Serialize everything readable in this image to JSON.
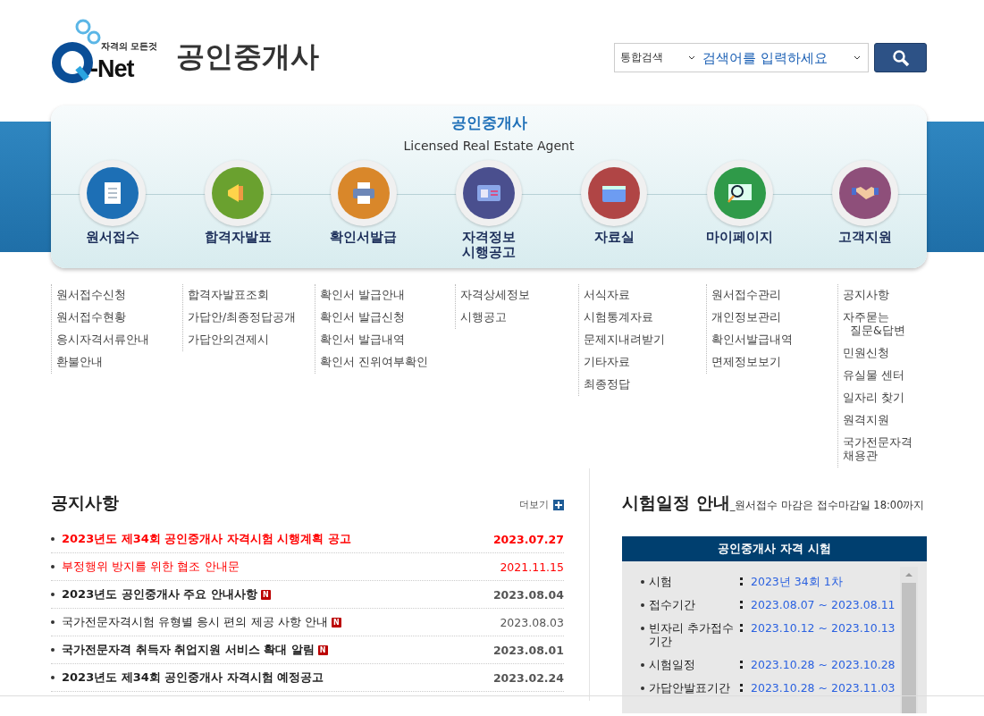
{
  "logo": {
    "tagline": "자격의 모든것",
    "brand": "-Net",
    "title": "공인중개사"
  },
  "search": {
    "scope": "통합검색",
    "placeholder": "검색어를 입력하세요"
  },
  "nav": {
    "title": "공인중개사",
    "subtitle": "Licensed Real Estate Agent",
    "items": [
      {
        "label": "원서접수",
        "links": [
          "원서접수신청",
          "원서접수현황",
          "응시자격서류안내",
          "환불안내"
        ]
      },
      {
        "label": "합격자발표",
        "links": [
          "합격자발표조회",
          "가답안/최종정답공개",
          "가답안의견제시"
        ]
      },
      {
        "label": "확인서발급",
        "links": [
          "확인서 발급안내",
          "확인서 발급신청",
          "확인서 발급내역",
          "확인서 진위여부확인"
        ]
      },
      {
        "label": "자격정보\n시행공고",
        "links": [
          "자격상세정보",
          "시행공고"
        ]
      },
      {
        "label": "자료실",
        "links": [
          "서식자료",
          "시험통계자료",
          "문제지내려받기",
          "기타자료",
          "최종정답"
        ]
      },
      {
        "label": "마이페이지",
        "links": [
          "원서접수관리",
          "개인정보관리",
          "확인서발급내역",
          "면제정보보기"
        ]
      },
      {
        "label": "고객지원",
        "links": [
          "공지사항",
          "자주묻는\n  질문&답변",
          "민원신청",
          "유실물 센터",
          "일자리 찾기",
          "원격지원",
          "국가전문자격\n채용관"
        ]
      }
    ]
  },
  "notices": {
    "title": "공지사항",
    "more": "더보기",
    "items": [
      {
        "title": "2023년도 제34회 공인중개사 자격시험 시행계획 공고",
        "date": "2023.07.27",
        "kind": "important",
        "new": false
      },
      {
        "title": "부정행위 방지를 위한 협조 안내문",
        "date": "2021.11.15",
        "kind": "alert",
        "new": false
      },
      {
        "title": "2023년도 공인중개사 주요 안내사항",
        "date": "2023.08.04",
        "kind": "bold",
        "new": true,
        "badge": "N"
      },
      {
        "title": "국가전문자격시험 유형별 응시 편의 제공 사항 안내",
        "date": "2023.08.03",
        "kind": "normal",
        "new": true,
        "badge": "N"
      },
      {
        "title": "국가전문자격 취득자 취업지원 서비스 확대 알림",
        "date": "2023.08.01",
        "kind": "bold",
        "new": true,
        "badge": "N"
      },
      {
        "title": "2023년도 제34회 공인중개사 자격시험 예정공고",
        "date": "2023.02.24",
        "kind": "bold",
        "new": false
      }
    ]
  },
  "schedule": {
    "title": "시험일정 안내",
    "note": "_원서접수 마감은 접수마감일 18:00까지",
    "box_title": "공인중개사 자격 시험",
    "rows": [
      {
        "label": "시험",
        "value": "2023년 34회 1차"
      },
      {
        "label": "접수기간",
        "value": "2023.08.07 ~ 2023.08.11"
      },
      {
        "label": "빈자리 추가접수\n기간",
        "value": "2023.10.12 ~ 2023.10.13"
      },
      {
        "label": "시험일정",
        "value": "2023.10.28 ~ 2023.10.28"
      },
      {
        "label": "가답안발표기간",
        "value": "2023.10.28 ~ 2023.11.03"
      }
    ]
  }
}
